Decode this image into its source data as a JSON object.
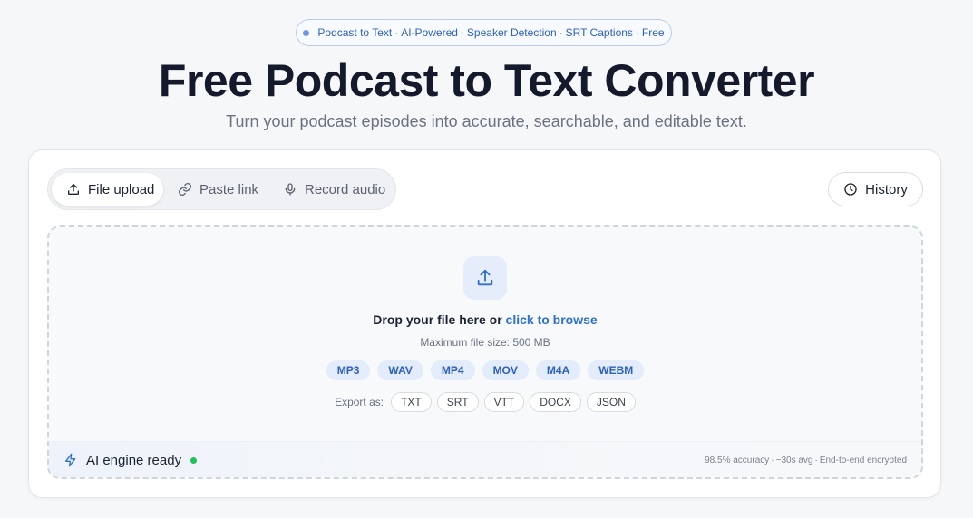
{
  "badge": {
    "items": [
      "Podcast to Text",
      "AI-Powered",
      "Speaker Detection",
      "SRT Captions",
      "Free"
    ],
    "separator": "·"
  },
  "hero": {
    "title": "Free Podcast to Text Converter",
    "subtitle": "Turn your podcast episodes into accurate, searchable, and editable text."
  },
  "tabs": [
    {
      "label": "File upload",
      "icon": "upload-icon",
      "active": true
    },
    {
      "label": "Paste link",
      "icon": "link-icon",
      "active": false
    },
    {
      "label": "Record audio",
      "icon": "microphone-icon",
      "active": false
    }
  ],
  "history": {
    "label": "History",
    "icon": "clock-icon"
  },
  "dropzone": {
    "prompt": "Drop your file here or ",
    "browse_link": "click to browse",
    "max_size": "Maximum file size: 500 MB",
    "formats": [
      "MP3",
      "WAV",
      "MP4",
      "MOV",
      "M4A",
      "WEBM"
    ],
    "export_label": "Export as:",
    "export_formats": [
      "TXT",
      "SRT",
      "VTT",
      "DOCX",
      "JSON"
    ]
  },
  "status": {
    "engine_label": "AI engine ready",
    "stats": [
      "98.5% accuracy",
      "~30s avg",
      "End-to-end encrypted"
    ],
    "separator": "·"
  },
  "colors": {
    "accent": "#2d6fd2",
    "ready": "#1fbf5a"
  }
}
